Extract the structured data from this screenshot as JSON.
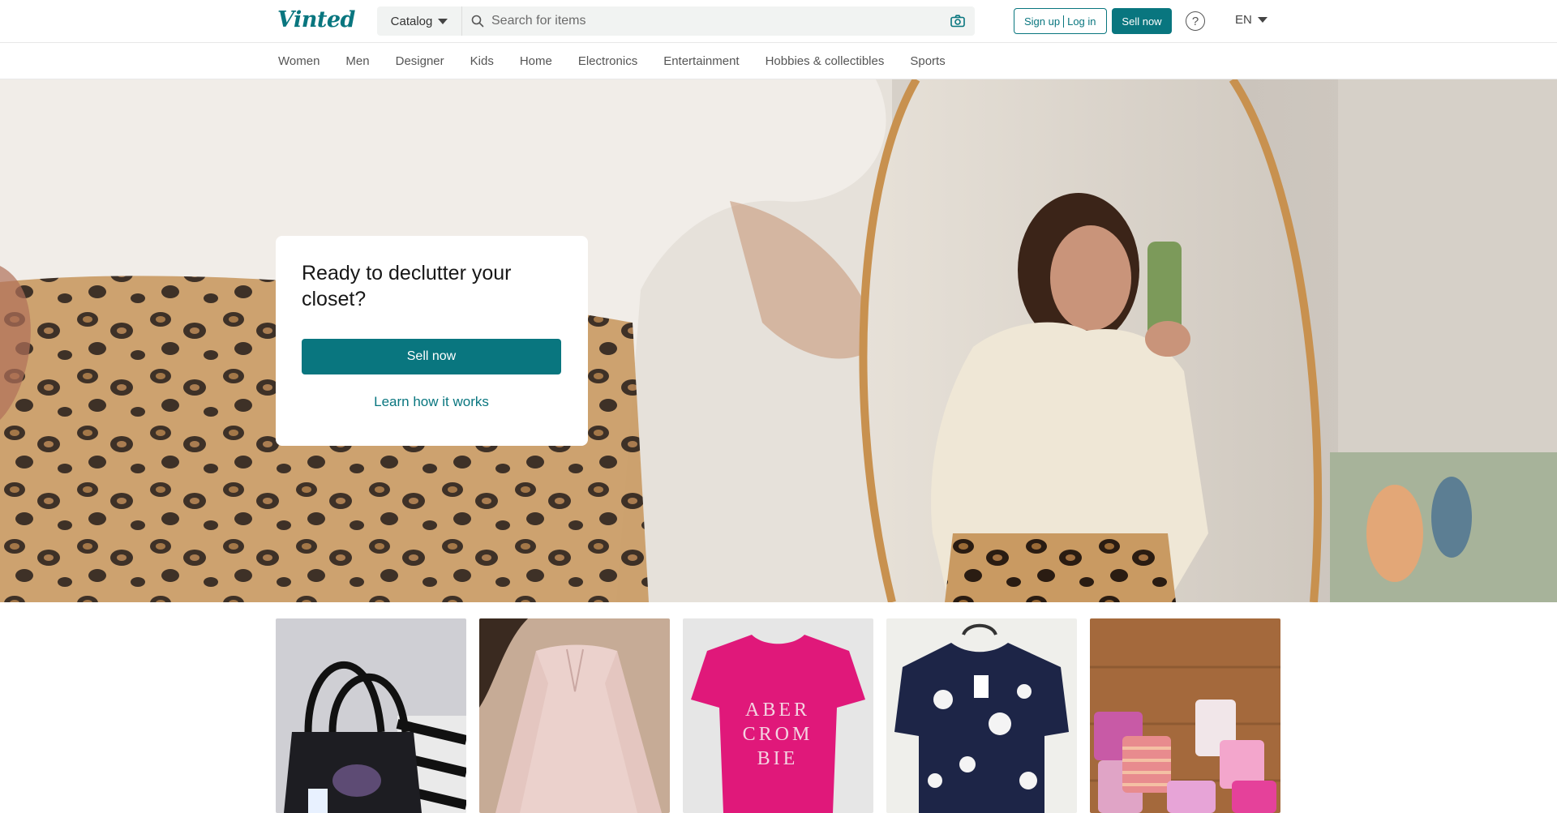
{
  "header": {
    "logo": "Vinted",
    "catalog_label": "Catalog",
    "search_placeholder": "Search for items",
    "signup_label": "Sign up",
    "login_label": "Log in",
    "sell_label": "Sell now",
    "help_glyph": "?",
    "language": "EN"
  },
  "nav": {
    "categories": [
      "Women",
      "Men",
      "Designer",
      "Kids",
      "Home",
      "Electronics",
      "Entertainment",
      "Hobbies & collectibles",
      "Sports"
    ]
  },
  "hero": {
    "title": "Ready to declutter your closet?",
    "sell_label": "Sell now",
    "learn_label": "Learn how it works"
  },
  "products": {
    "items": [
      {
        "icon": "handbag-photo"
      },
      {
        "icon": "pink-longsleeve-photo"
      },
      {
        "icon": "pink-tshirt-photo",
        "print_text": [
          "ABER",
          "CROM",
          "BIE"
        ]
      },
      {
        "icon": "floral-blouse-photo"
      },
      {
        "icon": "pink-shorts-photo"
      }
    ]
  },
  "colors": {
    "brand": "#09767f"
  }
}
